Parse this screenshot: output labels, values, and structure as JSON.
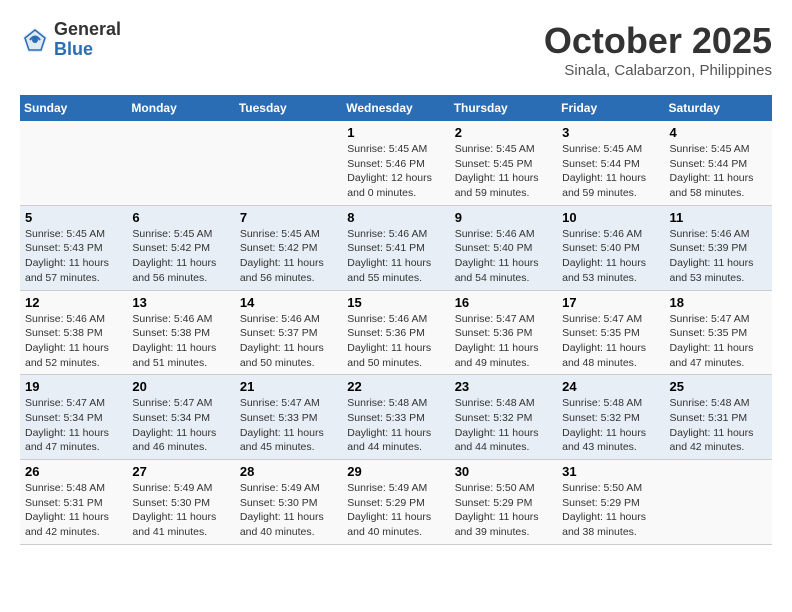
{
  "header": {
    "logo_general": "General",
    "logo_blue": "Blue",
    "month_title": "October 2025",
    "subtitle": "Sinala, Calabarzon, Philippines"
  },
  "weekdays": [
    "Sunday",
    "Monday",
    "Tuesday",
    "Wednesday",
    "Thursday",
    "Friday",
    "Saturday"
  ],
  "weeks": [
    [
      {
        "day": "",
        "info": ""
      },
      {
        "day": "",
        "info": ""
      },
      {
        "day": "",
        "info": ""
      },
      {
        "day": "1",
        "info": "Sunrise: 5:45 AM\nSunset: 5:46 PM\nDaylight: 12 hours\nand 0 minutes."
      },
      {
        "day": "2",
        "info": "Sunrise: 5:45 AM\nSunset: 5:45 PM\nDaylight: 11 hours\nand 59 minutes."
      },
      {
        "day": "3",
        "info": "Sunrise: 5:45 AM\nSunset: 5:44 PM\nDaylight: 11 hours\nand 59 minutes."
      },
      {
        "day": "4",
        "info": "Sunrise: 5:45 AM\nSunset: 5:44 PM\nDaylight: 11 hours\nand 58 minutes."
      }
    ],
    [
      {
        "day": "5",
        "info": "Sunrise: 5:45 AM\nSunset: 5:43 PM\nDaylight: 11 hours\nand 57 minutes."
      },
      {
        "day": "6",
        "info": "Sunrise: 5:45 AM\nSunset: 5:42 PM\nDaylight: 11 hours\nand 56 minutes."
      },
      {
        "day": "7",
        "info": "Sunrise: 5:45 AM\nSunset: 5:42 PM\nDaylight: 11 hours\nand 56 minutes."
      },
      {
        "day": "8",
        "info": "Sunrise: 5:46 AM\nSunset: 5:41 PM\nDaylight: 11 hours\nand 55 minutes."
      },
      {
        "day": "9",
        "info": "Sunrise: 5:46 AM\nSunset: 5:40 PM\nDaylight: 11 hours\nand 54 minutes."
      },
      {
        "day": "10",
        "info": "Sunrise: 5:46 AM\nSunset: 5:40 PM\nDaylight: 11 hours\nand 53 minutes."
      },
      {
        "day": "11",
        "info": "Sunrise: 5:46 AM\nSunset: 5:39 PM\nDaylight: 11 hours\nand 53 minutes."
      }
    ],
    [
      {
        "day": "12",
        "info": "Sunrise: 5:46 AM\nSunset: 5:38 PM\nDaylight: 11 hours\nand 52 minutes."
      },
      {
        "day": "13",
        "info": "Sunrise: 5:46 AM\nSunset: 5:38 PM\nDaylight: 11 hours\nand 51 minutes."
      },
      {
        "day": "14",
        "info": "Sunrise: 5:46 AM\nSunset: 5:37 PM\nDaylight: 11 hours\nand 50 minutes."
      },
      {
        "day": "15",
        "info": "Sunrise: 5:46 AM\nSunset: 5:36 PM\nDaylight: 11 hours\nand 50 minutes."
      },
      {
        "day": "16",
        "info": "Sunrise: 5:47 AM\nSunset: 5:36 PM\nDaylight: 11 hours\nand 49 minutes."
      },
      {
        "day": "17",
        "info": "Sunrise: 5:47 AM\nSunset: 5:35 PM\nDaylight: 11 hours\nand 48 minutes."
      },
      {
        "day": "18",
        "info": "Sunrise: 5:47 AM\nSunset: 5:35 PM\nDaylight: 11 hours\nand 47 minutes."
      }
    ],
    [
      {
        "day": "19",
        "info": "Sunrise: 5:47 AM\nSunset: 5:34 PM\nDaylight: 11 hours\nand 47 minutes."
      },
      {
        "day": "20",
        "info": "Sunrise: 5:47 AM\nSunset: 5:34 PM\nDaylight: 11 hours\nand 46 minutes."
      },
      {
        "day": "21",
        "info": "Sunrise: 5:47 AM\nSunset: 5:33 PM\nDaylight: 11 hours\nand 45 minutes."
      },
      {
        "day": "22",
        "info": "Sunrise: 5:48 AM\nSunset: 5:33 PM\nDaylight: 11 hours\nand 44 minutes."
      },
      {
        "day": "23",
        "info": "Sunrise: 5:48 AM\nSunset: 5:32 PM\nDaylight: 11 hours\nand 44 minutes."
      },
      {
        "day": "24",
        "info": "Sunrise: 5:48 AM\nSunset: 5:32 PM\nDaylight: 11 hours\nand 43 minutes."
      },
      {
        "day": "25",
        "info": "Sunrise: 5:48 AM\nSunset: 5:31 PM\nDaylight: 11 hours\nand 42 minutes."
      }
    ],
    [
      {
        "day": "26",
        "info": "Sunrise: 5:48 AM\nSunset: 5:31 PM\nDaylight: 11 hours\nand 42 minutes."
      },
      {
        "day": "27",
        "info": "Sunrise: 5:49 AM\nSunset: 5:30 PM\nDaylight: 11 hours\nand 41 minutes."
      },
      {
        "day": "28",
        "info": "Sunrise: 5:49 AM\nSunset: 5:30 PM\nDaylight: 11 hours\nand 40 minutes."
      },
      {
        "day": "29",
        "info": "Sunrise: 5:49 AM\nSunset: 5:29 PM\nDaylight: 11 hours\nand 40 minutes."
      },
      {
        "day": "30",
        "info": "Sunrise: 5:50 AM\nSunset: 5:29 PM\nDaylight: 11 hours\nand 39 minutes."
      },
      {
        "day": "31",
        "info": "Sunrise: 5:50 AM\nSunset: 5:29 PM\nDaylight: 11 hours\nand 38 minutes."
      },
      {
        "day": "",
        "info": ""
      }
    ]
  ]
}
